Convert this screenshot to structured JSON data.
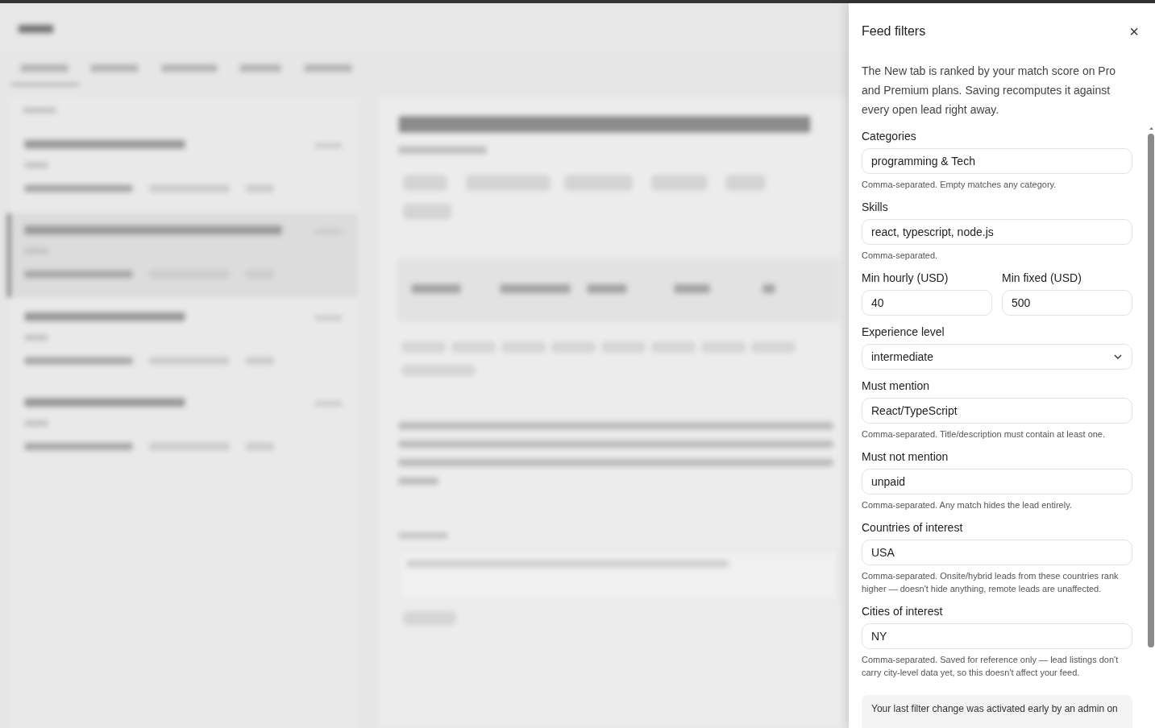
{
  "drawer": {
    "title": "Feed filters",
    "close_icon": "×",
    "intro": "The New tab is ranked by your match score on Pro and Premium plans. Saving recomputes it against every open lead right away.",
    "fields": [
      {
        "kind": "text",
        "label": "Categories",
        "value": "programming & Tech",
        "hint": "Comma-separated. Empty matches any category."
      },
      {
        "kind": "text",
        "label": "Skills",
        "value": "react, typescript, node.js",
        "hint": "Comma-separated."
      },
      {
        "kind": "pair",
        "items": [
          {
            "label": "Min hourly (USD)",
            "value": "40"
          },
          {
            "label": "Min fixed (USD)",
            "value": "500"
          }
        ]
      },
      {
        "kind": "select",
        "label": "Experience level",
        "value": "intermediate"
      },
      {
        "kind": "text",
        "label": "Must mention",
        "value": "React/TypeScript",
        "hint": "Comma-separated. Title/description must contain at least one."
      },
      {
        "kind": "text",
        "label": "Must not mention",
        "value": "unpaid",
        "hint": "Comma-separated. Any match hides the lead entirely."
      },
      {
        "kind": "text",
        "label": "Countries of interest",
        "value": "USA",
        "hint": "Comma-separated. Onsite/hybrid leads from these countries rank higher — doesn't hide anything, remote leads are unaffected."
      },
      {
        "kind": "text",
        "label": "Cities of interest",
        "value": "NY",
        "hint": "Comma-separated. Saved for reference only — lead listings don't carry city-level data yet, so this doesn't affect your feed."
      }
    ],
    "notice": "Your last filter change was activated early by an admin on"
  }
}
